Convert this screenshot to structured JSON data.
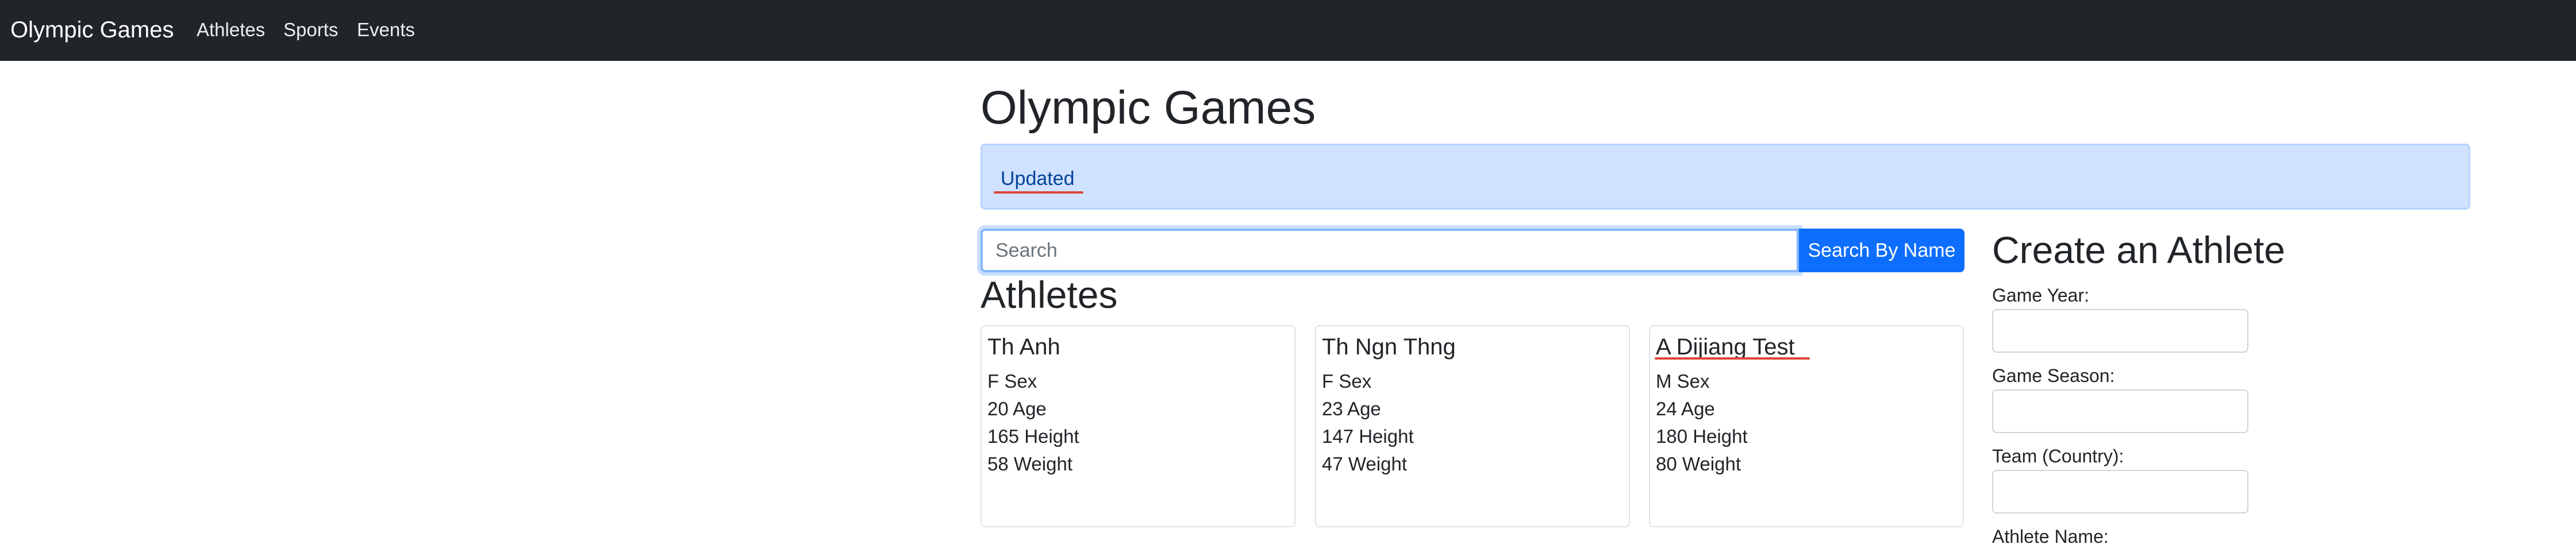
{
  "navbar": {
    "brand": "Olympic Games",
    "links": [
      "Athletes",
      "Sports",
      "Events"
    ]
  },
  "page": {
    "title": "Olympic Games"
  },
  "alert": {
    "text": "Updated"
  },
  "search": {
    "placeholder": "Search",
    "value": "",
    "button_label": "Search By Name"
  },
  "athletes": {
    "heading": "Athletes",
    "cards": [
      {
        "name": "Th Anh",
        "sex": "F Sex",
        "age": "20 Age",
        "height": "165 Height",
        "weight": "58 Weight"
      },
      {
        "name": "Th Ngn Thng",
        "sex": "F Sex",
        "age": "23 Age",
        "height": "147 Height",
        "weight": "47 Weight"
      },
      {
        "name": "A Dijiang Test",
        "sex": "M Sex",
        "age": "24 Age",
        "height": "180 Height",
        "weight": "80 Weight"
      }
    ]
  },
  "create_form": {
    "heading": "Create an Athlete",
    "fields": [
      {
        "label": "Game Year:",
        "value": ""
      },
      {
        "label": "Game Season:",
        "value": ""
      },
      {
        "label": "Team (Country):",
        "value": ""
      },
      {
        "label": "Athlete Name:",
        "value": ""
      }
    ]
  }
}
